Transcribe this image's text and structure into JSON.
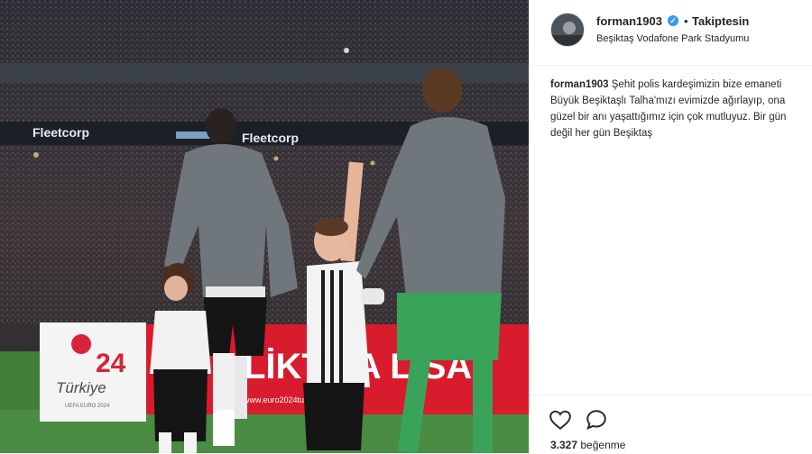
{
  "post": {
    "username": "forman1903",
    "verified_mark": "✓",
    "separator": "•",
    "follow_status": "Takiptesin",
    "location": "Beşiktaş Vodafone Park Stadyumu",
    "caption_username": "forman1903",
    "caption_text": "Şehit polis kardeşimizin bize emaneti Büyük Beşiktaşlı Talha'mızı evimizde ağırlayıp, ona güzel bir anı yaşattığımız için çok mutluyuz. Bir gün değil her gün Beşiktaş",
    "likes_count": "3.327",
    "likes_label": "beğenme"
  },
  "photo": {
    "board_left_text": "Fleetcorp",
    "board_right_text": "Fleetcorp",
    "ad_logo_text": "Türkiye",
    "ad_logo_sub": "UEFA EURO 2024",
    "ad_banner_text": "LİKT PA  LİSA",
    "ad_url": "www.euro2024turkiye.com",
    "colors": {
      "grass": "#3f7d39",
      "shirt": "#6f767c",
      "shorts_green": "#3aa35a"
    }
  },
  "icons": {
    "heart": "heart-icon",
    "comment": "comment-icon",
    "verified": "verified-badge-icon"
  }
}
